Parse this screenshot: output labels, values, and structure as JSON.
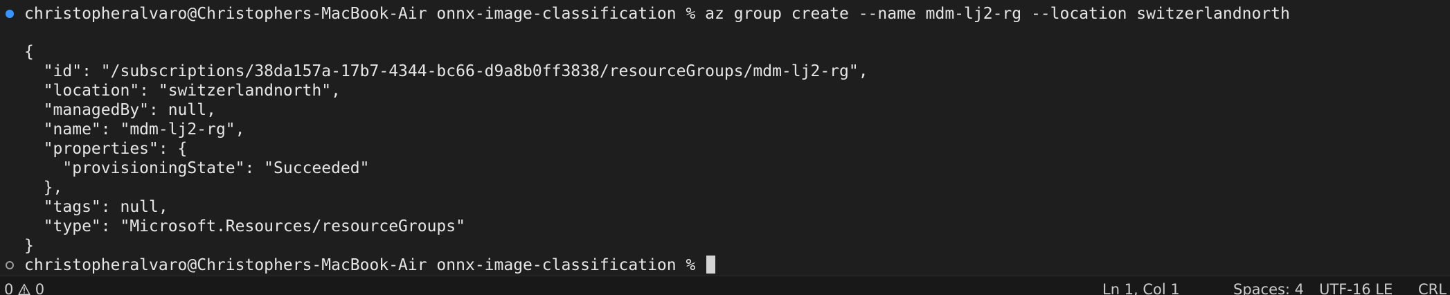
{
  "terminal": {
    "command_line": "christopheralvaro@Christophers-MacBook-Air onnx-image-classification % az group create --name mdm-lj2-rg --location switzerlandnorth",
    "output": [
      "{",
      "  \"id\": \"/subscriptions/38da157a-17b7-4344-bc66-d9a8b0ff3838/resourceGroups/mdm-lj2-rg\",",
      "  \"location\": \"switzerlandnorth\",",
      "  \"managedBy\": null,",
      "  \"name\": \"mdm-lj2-rg\",",
      "  \"properties\": {",
      "    \"provisioningState\": \"Succeeded\"",
      "  },",
      "  \"tags\": null,",
      "  \"type\": \"Microsoft.Resources/resourceGroups\"",
      "}"
    ],
    "prompt": "christopheralvaro@Christophers-MacBook-Air onnx-image-classification % "
  },
  "statusbar": {
    "errors": "0",
    "warnings": "0",
    "position": "Ln 1, Col 1",
    "spaces": "Spaces: 4",
    "encoding": "UTF-16 LE",
    "eol": "CRL"
  },
  "colors": {
    "background": "#1e1e1e",
    "text": "#e6e6e6",
    "decoration_success": "#3794ff",
    "statusbar_bg": "#181818"
  }
}
